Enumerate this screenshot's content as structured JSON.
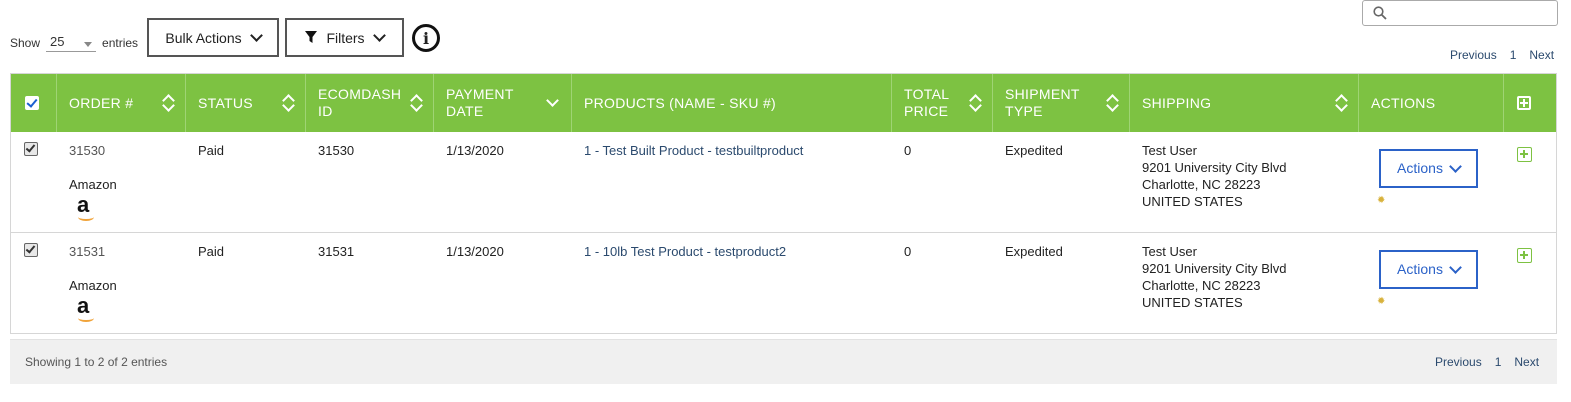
{
  "length_menu": {
    "prefix": "Show",
    "value": "25",
    "suffix": "entries"
  },
  "toolbar": {
    "bulk_actions": "Bulk Actions",
    "filters": "Filters",
    "info": "i"
  },
  "search": {
    "placeholder": ""
  },
  "pagination_top": {
    "previous": "Previous",
    "page": "1",
    "next": "Next"
  },
  "table": {
    "headers": {
      "order": "ORDER #",
      "status": "STATUS",
      "ecomdash_id": "ECOMDASH ID",
      "payment_date": "PAYMENT DATE",
      "products": "PRODUCTS (NAME - SKU #)",
      "total_price": "TOTAL PRICE",
      "shipment_type": "SHIPMENT TYPE",
      "shipping": "SHIPPING",
      "actions": "ACTIONS"
    },
    "rows": [
      {
        "checked": true,
        "order": "31530",
        "channel": "Amazon",
        "status": "Paid",
        "ecomdash_id": "31530",
        "payment_date": "1/13/2020",
        "product": "1 - Test Built Product - testbuiltproduct",
        "total_price": "0",
        "shipment_type": "Expedited",
        "ship_name": "Test User",
        "ship_street": "9201 University City Blvd",
        "ship_city": "Charlotte, NC 28223",
        "ship_country": "UNITED STATES",
        "actions_label": "Actions"
      },
      {
        "checked": true,
        "order": "31531",
        "channel": "Amazon",
        "status": "Paid",
        "ecomdash_id": "31531",
        "payment_date": "1/13/2020",
        "product": "1 - 10lb Test Product - testproduct2",
        "total_price": "0",
        "shipment_type": "Expedited",
        "ship_name": "Test User",
        "ship_street": "9201 University City Blvd",
        "ship_city": "Charlotte, NC 28223",
        "ship_country": "UNITED STATES",
        "actions_label": "Actions"
      }
    ]
  },
  "footer": {
    "info": "Showing 1 to 2 of 2 entries",
    "previous": "Previous",
    "page": "1",
    "next": "Next"
  },
  "colors": {
    "header_bg": "#7dc242",
    "link": "#2b4a6e",
    "actions_btn": "#2b62c8"
  }
}
